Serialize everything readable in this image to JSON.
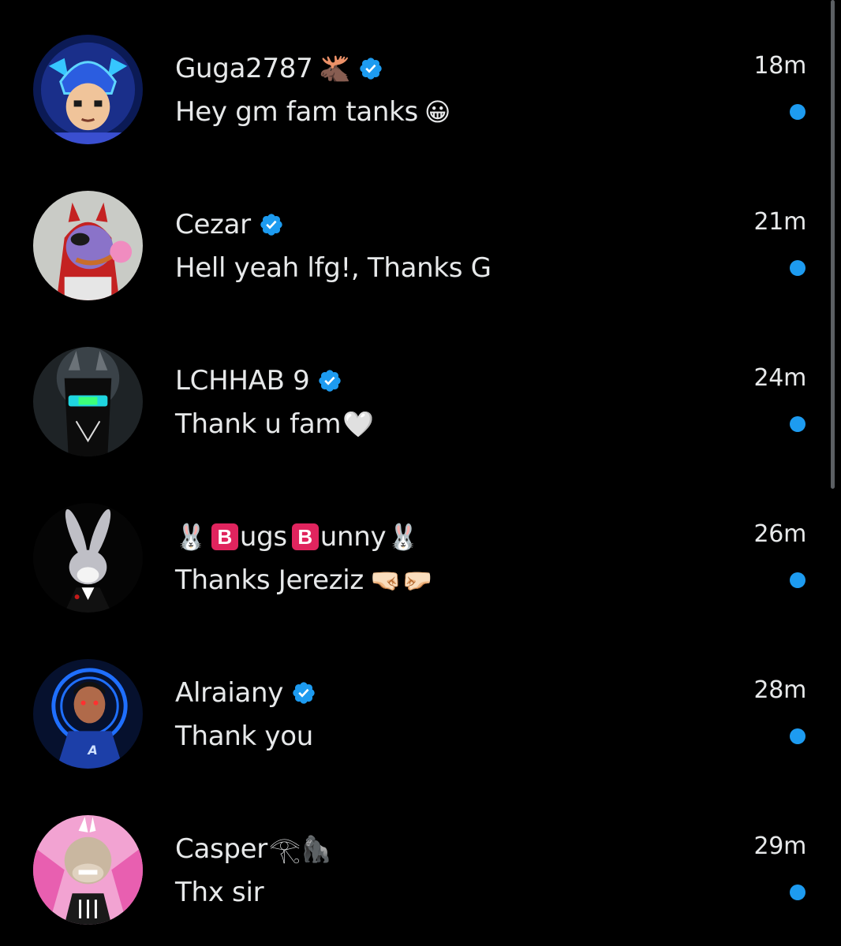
{
  "colors": {
    "background": "#000000",
    "text": "#e7e9ea",
    "accent": "#1d9bf0"
  },
  "conversations": [
    {
      "name": "Guga2787",
      "name_emoji": "🫎",
      "verified": true,
      "time": "18m",
      "message": "Hey gm fam tanks",
      "message_emoji": "😀",
      "unread": true,
      "avatar": "blue-helmet-anime-avatar"
    },
    {
      "name": "Cezar",
      "verified": true,
      "time": "21m",
      "message": "Hell yeah lfg!, Thanks G",
      "unread": true,
      "avatar": "purple-devil-cartoon-avatar"
    },
    {
      "name": "LCHHAB 9",
      "verified": true,
      "time": "24m",
      "message": "Thank u fam",
      "message_emoji": "🤍",
      "unread": true,
      "avatar": "dark-wolf-visor-avatar"
    },
    {
      "name_prefix_emoji": "🐰",
      "name_part1_letter": "B",
      "name_part1": "ugs",
      "name_part2_letter": "B",
      "name_part2": "unny",
      "name_suffix_emoji": "🐰",
      "verified": false,
      "time": "26m",
      "message": "Thanks Jereziz",
      "message_emoji": "🤜🏻🤛🏻",
      "unread": true,
      "avatar": "bugs-bunny-tuxedo-avatar"
    },
    {
      "name": "Alraiany",
      "verified": true,
      "time": "28m",
      "message": "Thank you",
      "unread": true,
      "avatar": "neon-jacket-man-avatar"
    },
    {
      "name": "Casper",
      "name_emoji": "𓂀🦍",
      "verified": false,
      "time": "29m",
      "message": "Thx sir",
      "unread": true,
      "avatar": "pink-ape-avatar"
    }
  ]
}
